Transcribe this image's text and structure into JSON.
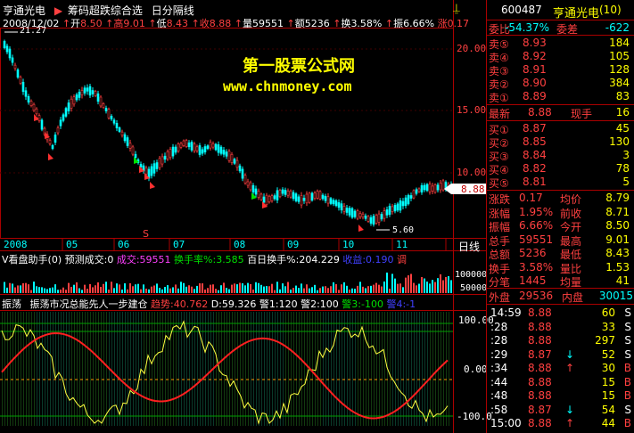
{
  "top_bar": {
    "stock_name": "亨通光电",
    "indicator_name": "筹码超跌综合选",
    "period": "日分隔线",
    "alarm_icon": "alarm-icon"
  },
  "quote_line": {
    "date": "2008/12/02",
    "open_label": "开",
    "open": "8.50",
    "high_label": "高",
    "high": "9.01",
    "low_label": "低",
    "low": "8.43",
    "close_label": "收",
    "close": "8.88",
    "volume_label": "量",
    "volume": "59551",
    "amount_label": "额",
    "amount": "5236",
    "turnover_label": "换",
    "turnover": "3.58%",
    "amplitude_label": "振",
    "amplitude": "6.66%",
    "change_label": "涨",
    "change": "0.17"
  },
  "main_chart": {
    "high_marker": "21.27",
    "low_marker": "5.60",
    "current_price_tag": "8.88",
    "y_ticks": [
      "20.00",
      "15.00",
      "10.00"
    ],
    "x_ticks": [
      "2008",
      "05",
      "06",
      "07",
      "08",
      "09",
      "10",
      "11"
    ],
    "s_marker": "S",
    "watermark_title": "第一股票公式网",
    "watermark_url": "www.chnmoney.com"
  },
  "volume_panel": {
    "title": "V看盘助手(0)",
    "subtitle": "预测成交:0",
    "deal_label": "成交:59551",
    "turnover_label": "换手率%:3.585",
    "hundred_day_label": "百日换手%:204.229",
    "profit_label": "收益:0.190",
    "extra_label": "调",
    "right_label": "日线",
    "y_ticks": [
      "100000",
      "50000"
    ]
  },
  "osc_panel": {
    "title": "振荡",
    "indicator": "振荡市况总能先人一步建仓",
    "trend_label": "趋势:40.762",
    "d_label": "D:59.326",
    "warn1": "警1:120",
    "warn2": "警2:100",
    "warn3": "警3:-100",
    "warn4": "警4:-1",
    "y_ticks": [
      "100.00",
      "0.00",
      "-100.0"
    ]
  },
  "quote_panel": {
    "code": "600487",
    "name": "亨通光电",
    "rank": "(10)",
    "weibi_label": "委比",
    "weibi": "-54.37%",
    "weicha_label": "委差",
    "weicha": "-622",
    "sells": [
      {
        "label": "卖⑤",
        "price": "8.93",
        "vol": "184"
      },
      {
        "label": "卖④",
        "price": "8.92",
        "vol": "105"
      },
      {
        "label": "卖③",
        "price": "8.91",
        "vol": "128"
      },
      {
        "label": "卖②",
        "price": "8.90",
        "vol": "384"
      },
      {
        "label": "卖①",
        "price": "8.89",
        "vol": "83"
      }
    ],
    "last_label": "最新",
    "last": "8.88",
    "current_hand_label": "现手",
    "current_hand": "16",
    "buys": [
      {
        "label": "买①",
        "price": "8.87",
        "vol": "45"
      },
      {
        "label": "买②",
        "price": "8.85",
        "vol": "130"
      },
      {
        "label": "买③",
        "price": "8.84",
        "vol": "3"
      },
      {
        "label": "买④",
        "price": "8.82",
        "vol": "78"
      },
      {
        "label": "买⑤",
        "price": "8.81",
        "vol": "5"
      }
    ],
    "stats": [
      {
        "l1": "涨跌",
        "v1": "0.17",
        "l2": "均价",
        "v2": "8.79"
      },
      {
        "l1": "涨幅",
        "v1": "1.95%",
        "l2": "前收",
        "v2": "8.71"
      },
      {
        "l1": "振幅",
        "v1": "6.66%",
        "l2": "今开",
        "v2": "8.50"
      },
      {
        "l1": "总手",
        "v1": "59551",
        "l2": "最高",
        "v2": "9.01"
      },
      {
        "l1": "总额",
        "v1": "5236",
        "l2": "最低",
        "v2": "8.43"
      },
      {
        "l1": "换手",
        "v1": "3.58%",
        "l2": "量比",
        "v2": "1.53"
      },
      {
        "l1": "分笔",
        "v1": "1445",
        "l2": "均量",
        "v2": "41"
      }
    ],
    "outer_label": "外盘",
    "outer": "29536",
    "inner_label": "内盘",
    "inner": "30015",
    "ticks": [
      {
        "time": "14:59",
        "price": "8.88",
        "arrow": "",
        "vol": "60",
        "side": "S"
      },
      {
        "time": ":28",
        "price": "8.88",
        "arrow": "",
        "vol": "33",
        "side": "S"
      },
      {
        "time": ":28",
        "price": "8.88",
        "arrow": "",
        "vol": "297",
        "side": "S"
      },
      {
        "time": ":29",
        "price": "8.87",
        "arrow": "↓",
        "vol": "52",
        "side": "S"
      },
      {
        "time": ":34",
        "price": "8.88",
        "arrow": "↑",
        "vol": "30",
        "side": "B"
      },
      {
        "time": ":44",
        "price": "8.88",
        "arrow": "",
        "vol": "15",
        "side": "B"
      },
      {
        "time": ":48",
        "price": "8.88",
        "arrow": "",
        "vol": "15",
        "side": "B"
      },
      {
        "time": ":58",
        "price": "8.87",
        "arrow": "↓",
        "vol": "54",
        "side": "S"
      },
      {
        "time": "15:00",
        "price": "8.88",
        "arrow": "↑",
        "vol": "44",
        "side": "B"
      }
    ]
  },
  "colors": {
    "up": "#ff4040",
    "down": "#00ffff",
    "frame": "#aa0000",
    "trend": "#ff2020",
    "d_line": "#ffff40"
  }
}
